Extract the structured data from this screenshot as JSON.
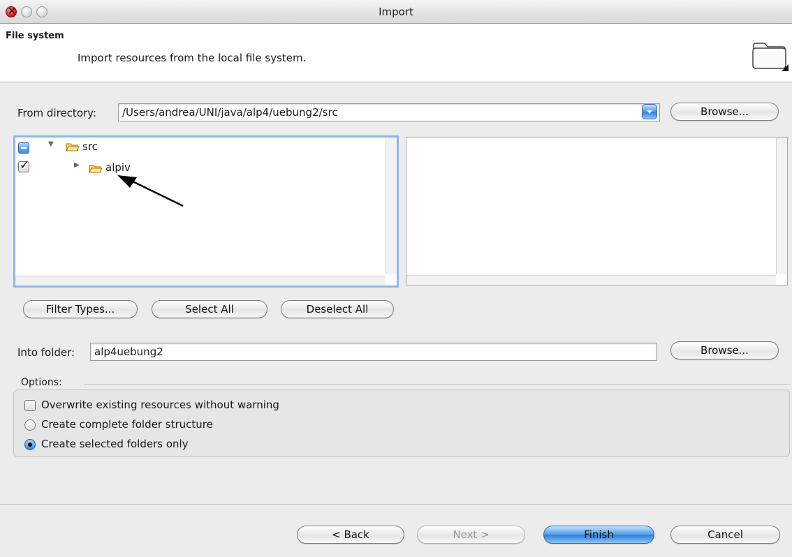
{
  "window": {
    "title": "Import"
  },
  "banner": {
    "title": "File system",
    "description": "Import resources from the local file system."
  },
  "source": {
    "label": "From directory:",
    "value": "/Users/andrea/UNI/java/alp4/uebung2/src",
    "browse_label": "Browse..."
  },
  "tree": {
    "items": [
      {
        "label": "src",
        "expanded": true,
        "check_state": "mixed"
      },
      {
        "label": "alpiv",
        "expanded": false,
        "check_state": "checked"
      }
    ]
  },
  "selection_buttons": {
    "filter_label": "Filter Types...",
    "select_all_label": "Select All",
    "deselect_all_label": "Deselect All"
  },
  "destination": {
    "label": "Into folder:",
    "value": "alp4uebung2",
    "browse_label": "Browse..."
  },
  "options": {
    "title": "Options:",
    "overwrite_label": "Overwrite existing resources without warning",
    "overwrite_checked": false,
    "complete_structure_label": "Create complete folder structure",
    "selected_only_label": "Create selected folders only",
    "selected_mode": "selected_only"
  },
  "footer": {
    "back_label": "< Back",
    "next_label": "Next >",
    "finish_label": "Finish",
    "cancel_label": "Cancel"
  },
  "colors": {
    "accent": "#3c88d8",
    "focus_ring": "#8fb7e8",
    "window_bg": "#ececec"
  }
}
